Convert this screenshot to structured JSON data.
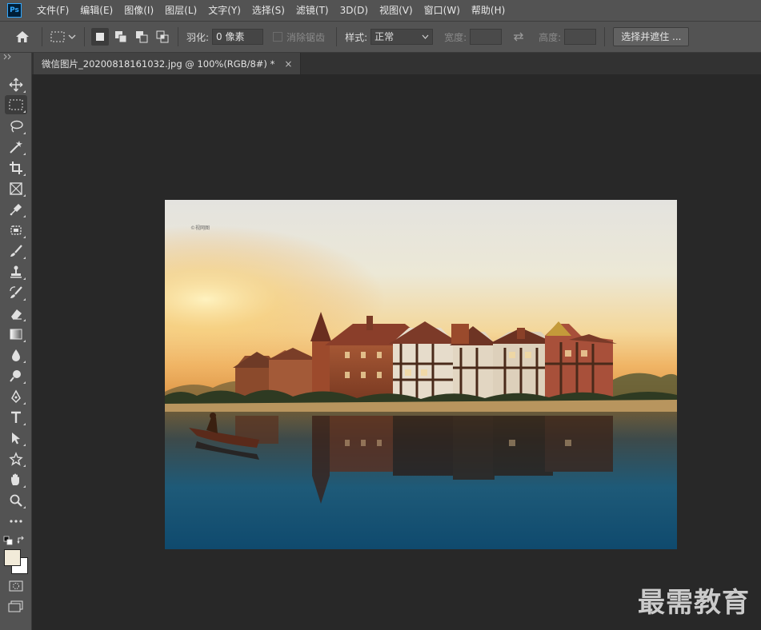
{
  "app": {
    "logo_text": "Ps",
    "menu": [
      "文件(F)",
      "编辑(E)",
      "图像(I)",
      "图层(L)",
      "文字(Y)",
      "选择(S)",
      "滤镜(T)",
      "3D(D)",
      "视图(V)",
      "窗口(W)",
      "帮助(H)"
    ]
  },
  "options": {
    "feather_label": "羽化:",
    "feather_value": "0 像素",
    "antialias_label": "消除锯齿",
    "style_label": "样式:",
    "style_value": "正常",
    "width_label": "宽度:",
    "height_label": "高度:",
    "select_mask_label": "选择并遮住 ..."
  },
  "document": {
    "tab_title": "微信图片_20200818161032.jpg @ 100%(RGB/8#) *",
    "close_glyph": "×",
    "image_watermark_text": "©视网图"
  },
  "tools": [
    {
      "name": "move-tool",
      "icon": "move-icon"
    },
    {
      "name": "marquee-tool",
      "icon": "rect-marquee-icon",
      "active": true
    },
    {
      "name": "lasso-tool",
      "icon": "lasso-icon"
    },
    {
      "name": "magic-wand-tool",
      "icon": "magic-wand-icon"
    },
    {
      "name": "crop-tool",
      "icon": "crop-icon"
    },
    {
      "name": "frame-tool",
      "icon": "frame-icon"
    },
    {
      "name": "eyedropper-tool",
      "icon": "eyedropper-icon"
    },
    {
      "name": "healing-tool",
      "icon": "bandage-icon"
    },
    {
      "name": "brush-tool",
      "icon": "brush-icon"
    },
    {
      "name": "stamp-tool",
      "icon": "stamp-icon"
    },
    {
      "name": "history-brush-tool",
      "icon": "history-brush-icon"
    },
    {
      "name": "eraser-tool",
      "icon": "eraser-icon"
    },
    {
      "name": "gradient-tool",
      "icon": "gradient-icon"
    },
    {
      "name": "blur-tool",
      "icon": "drop-icon"
    },
    {
      "name": "dodge-tool",
      "icon": "dodge-icon"
    },
    {
      "name": "pen-tool",
      "icon": "pen-icon"
    },
    {
      "name": "type-tool",
      "icon": "type-icon"
    },
    {
      "name": "path-select-tool",
      "icon": "arrow-icon"
    },
    {
      "name": "shape-tool",
      "icon": "shape-icon"
    },
    {
      "name": "hand-tool",
      "icon": "hand-icon"
    },
    {
      "name": "zoom-tool",
      "icon": "zoom-icon"
    },
    {
      "name": "more-tools",
      "icon": "ellipsis-icon"
    }
  ],
  "colors": {
    "foreground": "#f2ebd9",
    "background": "#ffffff",
    "ui_bg": "#535353",
    "workspace": "#282828"
  },
  "watermark": "最需教育"
}
